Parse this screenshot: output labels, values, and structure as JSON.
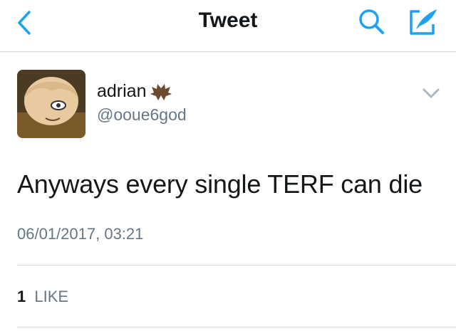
{
  "nav": {
    "title": "Tweet",
    "accent_color": "#1da1f2",
    "back_icon": "chevron-left-icon",
    "search_icon": "search-icon",
    "compose_icon": "compose-tweet-icon"
  },
  "author": {
    "display_name": "adrian",
    "emoji": "bat-emoji",
    "handle": "@ooue6god"
  },
  "tweet": {
    "text": "Anyways every single TERF can die",
    "timestamp": "06/01/2017, 03:21"
  },
  "stats": {
    "likes_count": "1",
    "likes_label": "LIKE"
  }
}
